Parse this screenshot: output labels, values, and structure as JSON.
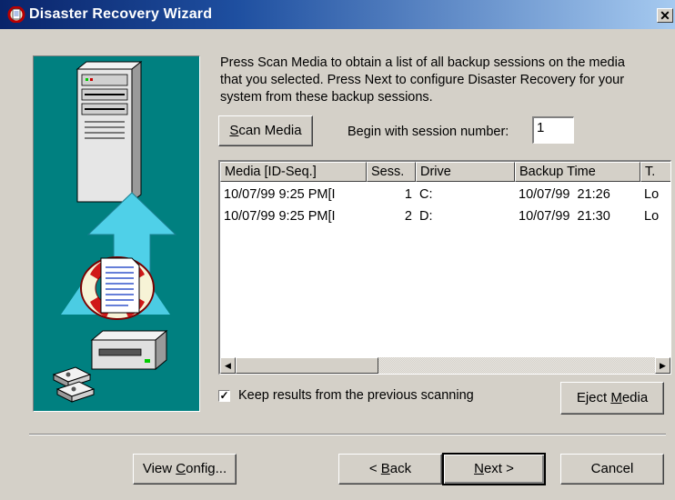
{
  "window": {
    "title": "Disaster Recovery Wizard",
    "close_glyph": "✕"
  },
  "instructions": "Press Scan Media to obtain a list of all backup sessions on the media that you selected. Press Next to configure Disaster Recovery for your system from these backup sessions.",
  "scan": {
    "button_mnemonic": "S",
    "button_rest": "can Media",
    "session_label": "Begin with session number:",
    "session_value": "1"
  },
  "table": {
    "columns": [
      "Media [ID-Seq.]",
      "Sess.",
      "Drive",
      "Backup Time",
      "T."
    ],
    "rows": [
      {
        "media": "10/07/99 9:25 PM[I",
        "session": "1",
        "drive": "C:",
        "time": "10/07/99  21:26",
        "type": "Lo"
      },
      {
        "media": "10/07/99 9:25 PM[I",
        "session": "2",
        "drive": "D:",
        "time": "10/07/99  21:30",
        "type": "Lo"
      }
    ]
  },
  "keep_results": {
    "label": "Keep results from the previous scanning",
    "checked": true,
    "glyph": "✓"
  },
  "buttons": {
    "eject": {
      "pre": "Eject ",
      "mnemonic": "M",
      "post": "edia"
    },
    "view_config": {
      "pre": "View ",
      "mnemonic": "C",
      "post": "onfig..."
    },
    "back": {
      "pre": "< ",
      "mnemonic": "B",
      "post": "ack"
    },
    "next": {
      "pre": "",
      "mnemonic": "N",
      "post": "ext >"
    },
    "cancel": "Cancel"
  },
  "icons": [
    "disaster-recovery-app-icon",
    "server-tower-icon",
    "arrow-up-icon",
    "life-ring-icon",
    "document-icon",
    "tape-drive-icon",
    "tape-cartridge-icon"
  ],
  "colors": {
    "illustration_bg": "#008080",
    "dialog_bg": "#d4d0c8",
    "arrow": "#4fd0e8"
  }
}
